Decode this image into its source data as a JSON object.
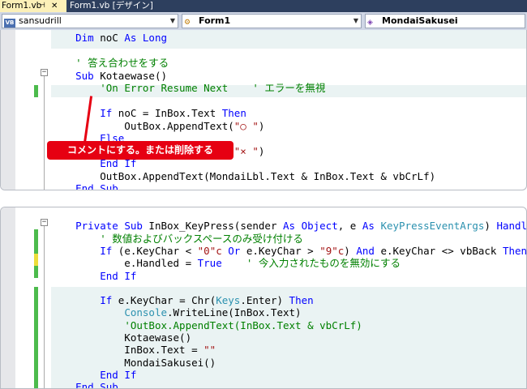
{
  "tabs": [
    {
      "label": "Form1.vb",
      "pin": "⊣",
      "close": "✕"
    },
    {
      "label": "Form1.vb [デザイン]"
    }
  ],
  "navbar": {
    "project": "sansudrill",
    "object": "Form1",
    "member": "MondaiSakusei"
  },
  "callout": "コメントにする。または削除する",
  "panel1": [
    {
      "spans": [
        {
          "t": "    "
        },
        {
          "t": "Dim",
          "c": "kw"
        },
        {
          "t": " noC "
        },
        {
          "t": "As Long",
          "c": "kw"
        }
      ]
    },
    {
      "spans": []
    },
    {
      "spans": [
        {
          "t": "    "
        },
        {
          "t": "' 答え合わせをする",
          "c": "cm"
        }
      ]
    },
    {
      "spans": [
        {
          "t": "    "
        },
        {
          "t": "Sub",
          "c": "kw"
        },
        {
          "t": " Kotaewase()"
        }
      ]
    },
    {
      "spans": [
        {
          "t": "        "
        },
        {
          "t": "'On Error Resume Next    ' エラーを無視",
          "c": "cm"
        }
      ]
    },
    {
      "spans": []
    },
    {
      "spans": [
        {
          "t": "        "
        },
        {
          "t": "If",
          "c": "kw"
        },
        {
          "t": " noC = InBox.Text "
        },
        {
          "t": "Then",
          "c": "kw"
        }
      ]
    },
    {
      "spans": [
        {
          "t": "            OutBox.AppendText("
        },
        {
          "t": "\"○ \"",
          "c": "st"
        },
        {
          "t": ")"
        }
      ]
    },
    {
      "spans": [
        {
          "t": "        "
        },
        {
          "t": "Else",
          "c": "kw"
        }
      ]
    },
    {
      "spans": [
        {
          "t": "            OutBox.AppendText("
        },
        {
          "t": "\"× \"",
          "c": "st"
        },
        {
          "t": ")"
        }
      ]
    },
    {
      "spans": [
        {
          "t": "        "
        },
        {
          "t": "End If",
          "c": "kw"
        }
      ]
    },
    {
      "spans": [
        {
          "t": "        OutBox.AppendText(MondaiLbl.Text & InBox.Text & vbCrLf)"
        }
      ]
    },
    {
      "spans": [
        {
          "t": "    "
        },
        {
          "t": "End Sub",
          "c": "kw"
        }
      ]
    }
  ],
  "panel2": [
    {
      "spans": []
    },
    {
      "spans": [
        {
          "t": "    "
        },
        {
          "t": "Private Sub",
          "c": "kw"
        },
        {
          "t": " InBox_KeyPress(sender "
        },
        {
          "t": "As Object",
          "c": "kw"
        },
        {
          "t": ", e "
        },
        {
          "t": "As",
          "c": "kw"
        },
        {
          "t": " "
        },
        {
          "t": "KeyPressEventArgs",
          "c": "ty"
        },
        {
          "t": ") "
        },
        {
          "t": "Handles",
          "c": "kw"
        },
        {
          "t": " InBox.KeyPress"
        }
      ]
    },
    {
      "spans": [
        {
          "t": "        "
        },
        {
          "t": "' 数値およびバックスペースのみ受け付ける",
          "c": "cm"
        }
      ]
    },
    {
      "spans": [
        {
          "t": "        "
        },
        {
          "t": "If",
          "c": "kw"
        },
        {
          "t": " (e.KeyChar < "
        },
        {
          "t": "\"0\"c",
          "c": "st"
        },
        {
          "t": " "
        },
        {
          "t": "Or",
          "c": "kw"
        },
        {
          "t": " e.KeyChar > "
        },
        {
          "t": "\"9\"c",
          "c": "st"
        },
        {
          "t": ") "
        },
        {
          "t": "And",
          "c": "kw"
        },
        {
          "t": " e.KeyChar <> vbBack "
        },
        {
          "t": "Then",
          "c": "kw"
        }
      ]
    },
    {
      "spans": [
        {
          "t": "            e.Handled = "
        },
        {
          "t": "True",
          "c": "kw"
        },
        {
          "t": "    "
        },
        {
          "t": "' 今入力されたものを無効にする",
          "c": "cm"
        }
      ]
    },
    {
      "spans": [
        {
          "t": "        "
        },
        {
          "t": "End If",
          "c": "kw"
        }
      ]
    },
    {
      "spans": []
    },
    {
      "spans": [
        {
          "t": "        "
        },
        {
          "t": "If",
          "c": "kw"
        },
        {
          "t": " e.KeyChar = Chr("
        },
        {
          "t": "Keys",
          "c": "ty"
        },
        {
          "t": ".Enter) "
        },
        {
          "t": "Then",
          "c": "kw"
        }
      ]
    },
    {
      "spans": [
        {
          "t": "            "
        },
        {
          "t": "Console",
          "c": "ty"
        },
        {
          "t": ".WriteLine(InBox.Text)"
        }
      ]
    },
    {
      "spans": [
        {
          "t": "            "
        },
        {
          "t": "'OutBox.AppendText(InBox.Text & vbCrLf)",
          "c": "cm"
        }
      ]
    },
    {
      "spans": [
        {
          "t": "            Kotaewase()"
        }
      ]
    },
    {
      "spans": [
        {
          "t": "            InBox.Text = "
        },
        {
          "t": "\"\"",
          "c": "st"
        }
      ]
    },
    {
      "spans": [
        {
          "t": "            MondaiSakusei()"
        }
      ]
    },
    {
      "spans": [
        {
          "t": "        "
        },
        {
          "t": "End If",
          "c": "kw"
        }
      ]
    },
    {
      "spans": [
        {
          "t": "    "
        },
        {
          "t": "End Sub",
          "c": "kw"
        }
      ]
    }
  ]
}
